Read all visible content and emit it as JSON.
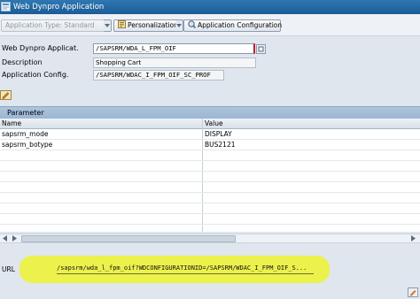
{
  "window": {
    "title": "Web Dynpro Application"
  },
  "toolbar": {
    "application_type_label": "Application Type: Standard",
    "personalization_label": "Personalization",
    "app_config_label": "Application Configuration"
  },
  "form": {
    "app_label": "Web Dynpro Applicat.",
    "app_value": "/SAPSRM/WDA_L_FPM_OIF",
    "description_label": "Description",
    "description_value": "Shopping Cart",
    "config_label": "Application Config.",
    "config_value": "/SAPSRM/WDAC_I_FPM_OIF_SC_PROF"
  },
  "parameter_panel": {
    "title": "Parameter",
    "columns": [
      "Name",
      "Value"
    ],
    "rows": [
      {
        "name": "sapsrm_mode",
        "value": "DISPLAY"
      },
      {
        "name": "sapsrm_botype",
        "value": "BUS2121"
      }
    ]
  },
  "url": {
    "label": "URL",
    "value": "/sapsrm/wda_l_fpm_oif?WDCONFIGURATIONID=/SAPSRM/WDAC_I_FPM_OIF_S..."
  },
  "colors": {
    "title_bar": "#1c5c96",
    "highlight": "#eef23a",
    "panel_header": "#9bb7d4"
  }
}
